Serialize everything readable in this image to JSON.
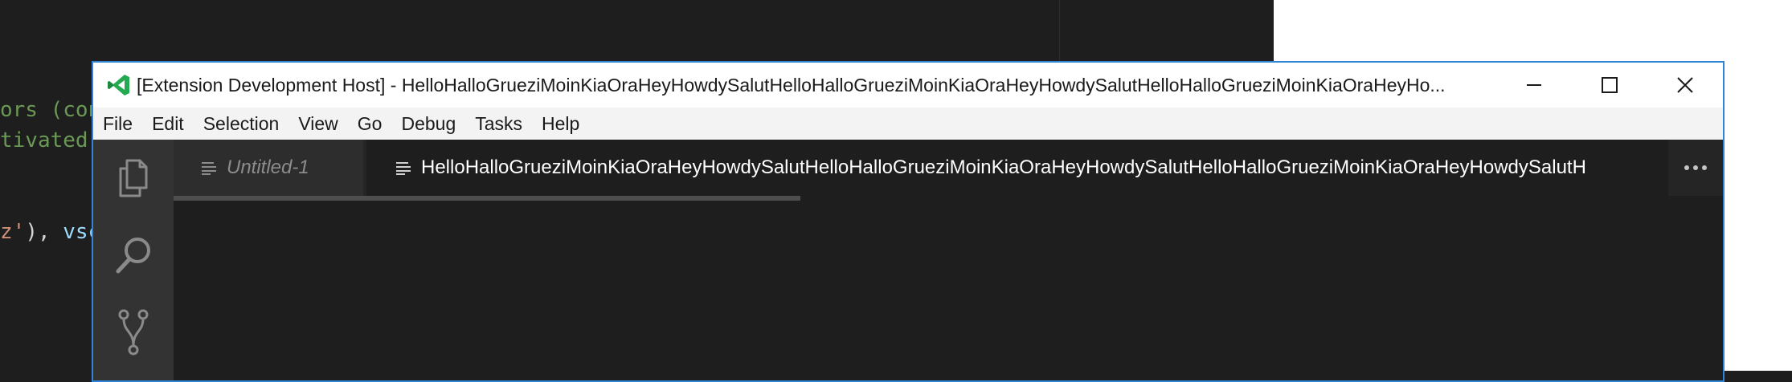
{
  "background_editor": {
    "line1": "ors (con",
    "line2": "tivated",
    "line3_str": "z'",
    "line3_mid": "), ",
    "line3_var": "vsc"
  },
  "window": {
    "title": "[Extension Development Host] - HelloHalloGrueziMoinKiaOraHeyHowdySalutHelloHalloGrueziMoinKiaOraHeyHowdySalutHelloHalloGrueziMoinKiaOraHeyHo...",
    "controls": {
      "minimize_icon": "minimize-icon",
      "maximize_icon": "maximize-icon",
      "close_icon": "close-icon"
    }
  },
  "menu": [
    "File",
    "Edit",
    "Selection",
    "View",
    "Go",
    "Debug",
    "Tasks",
    "Help"
  ],
  "activity_bar": [
    "explorer-icon",
    "search-icon",
    "source-control-icon"
  ],
  "tabs": [
    {
      "label": "Untitled-1",
      "icon": "file-lines-icon",
      "active": false
    },
    {
      "label": "HelloHalloGrueziMoinKiaOraHeyHowdySalutHelloHalloGrueziMoinKiaOraHeyHowdySalutHelloHalloGrueziMoinKiaOraHeyHowdySalutH",
      "icon": "file-lines-icon",
      "active": true
    }
  ],
  "more_actions_icon": "more-actions-icon",
  "colors": {
    "accent": "#2f84d6",
    "logo": "#23a94f"
  }
}
